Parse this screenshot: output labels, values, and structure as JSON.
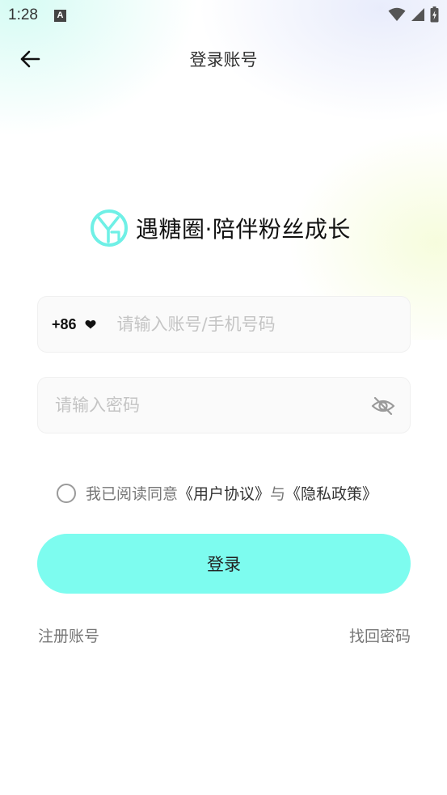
{
  "status_bar": {
    "time": "1:28",
    "notification_badge": "A",
    "icons": [
      "wifi-icon",
      "signal-icon",
      "battery-charging-icon"
    ]
  },
  "header": {
    "title": "登录账号",
    "back_icon": "arrow-left-icon"
  },
  "brand": {
    "logo_icon": "brand-logo-icon",
    "slogan": "遇糖圈·陪伴粉丝成长"
  },
  "form": {
    "country_code": "+86",
    "country_code_icon": "caret-down-icon",
    "account_placeholder": "请输入账号/手机号码",
    "account_value": "",
    "password_placeholder": "请输入密码",
    "password_value": "",
    "password_toggle_icon": "eye-off-icon"
  },
  "agreement": {
    "checked": false,
    "prefix": "我已阅读同意",
    "user_agreement": "《用户协议》",
    "connector": "与",
    "privacy_policy": "《隐私政策》"
  },
  "login_button": "登录",
  "footer": {
    "register": "注册账号",
    "forgot_password": "找回密码"
  },
  "colors": {
    "accent": "#7dfcef",
    "logo": "#6ff0e6",
    "text_primary": "#111111",
    "text_secondary": "#777777",
    "placeholder": "#c4c4c4"
  }
}
